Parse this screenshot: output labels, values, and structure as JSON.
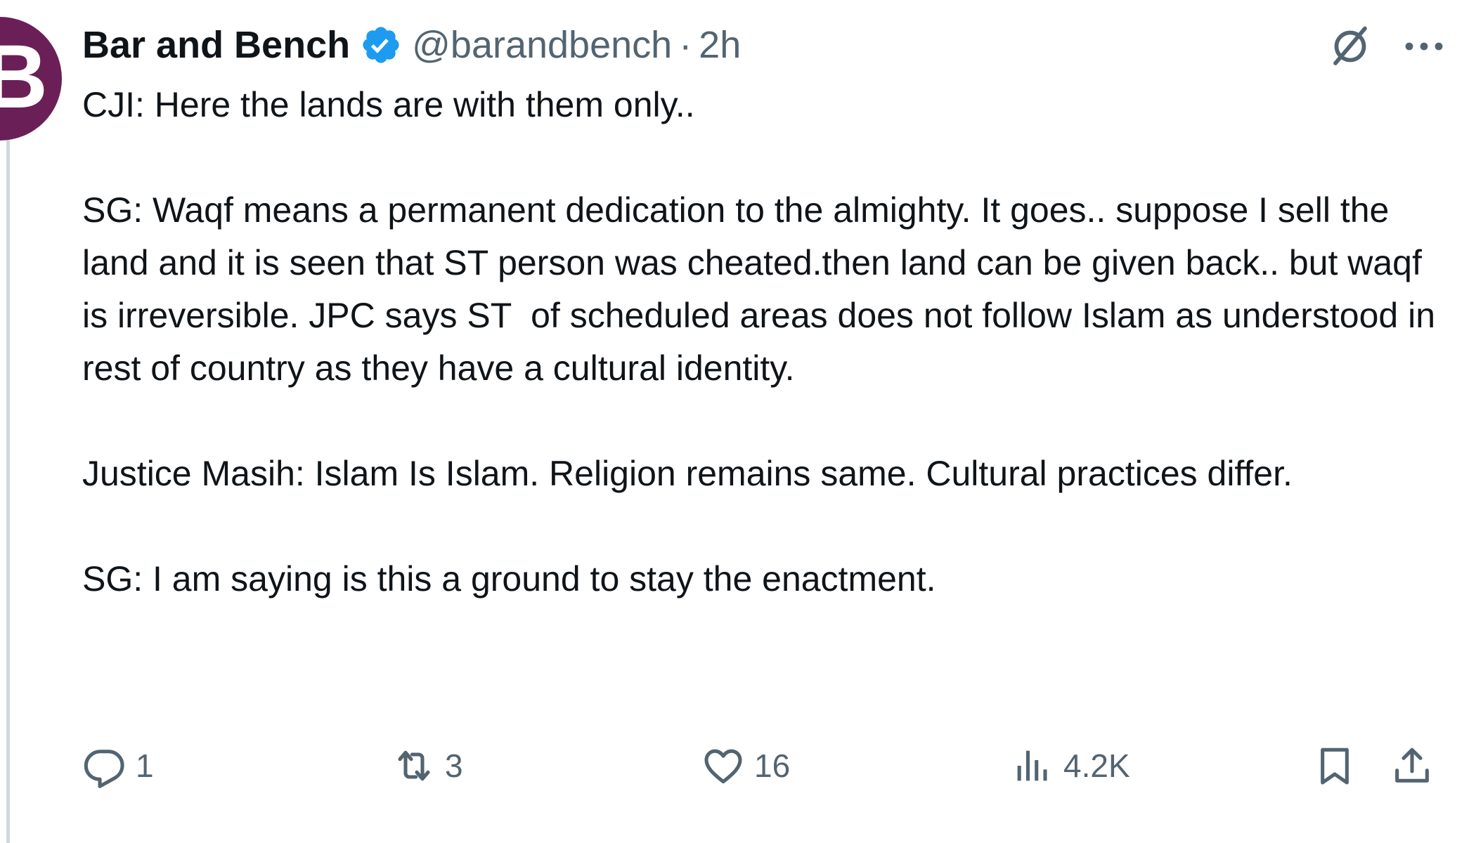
{
  "tweet": {
    "author": {
      "display_name": "Bar and Bench",
      "handle": "@barandbench",
      "separator": "·",
      "time": "2h",
      "avatar_letter": "B",
      "avatar_color": "#6b1f57",
      "verified": true,
      "verified_color": "#1d9bf0"
    },
    "paragraphs": [
      "CJI: Here the lands are with them only..",
      "SG: Waqf means a permanent dedication to the almighty. It goes.. suppose I sell the land and it is seen that ST person was cheated.then land can be given back.. but waqf is irreversible. JPC says ST  of scheduled areas does not follow Islam as understood in rest of country as they have a cultural identity.",
      "Justice Masih: Islam Is Islam. Religion remains same. Cultural practices differ.",
      "SG: I am saying is this a ground to stay the enactment."
    ],
    "actions": {
      "replies": "1",
      "reposts": "3",
      "likes": "16",
      "views": "4.2K"
    },
    "icons": {
      "header": [
        "verified-badge-icon",
        "grok-icon",
        "more-options-icon"
      ],
      "actions": [
        "reply-icon",
        "repost-icon",
        "like-icon",
        "views-icon",
        "bookmark-icon",
        "share-icon"
      ]
    },
    "colors": {
      "text": "#0f1419",
      "secondary": "#536471",
      "thread_line": "#cfd9de"
    }
  }
}
